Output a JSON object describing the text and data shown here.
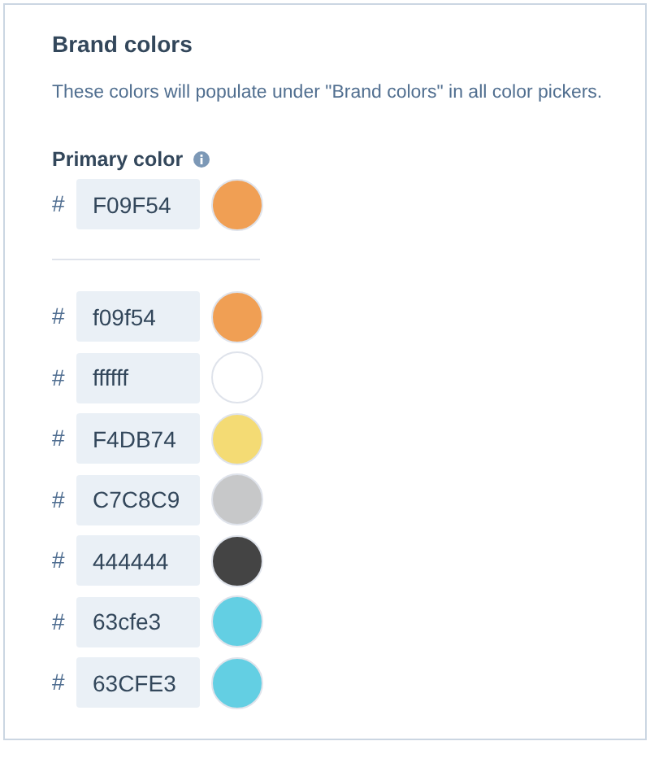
{
  "title": "Brand colors",
  "description": "These colors will populate under \"Brand colors\" in all color pickers.",
  "primary": {
    "label": "Primary color",
    "prefix": "#",
    "value": "F09F54",
    "color": "#f09f54"
  },
  "colors": [
    {
      "prefix": "#",
      "value": "f09f54",
      "color": "#f09f54"
    },
    {
      "prefix": "#",
      "value": "ffffff",
      "color": "#ffffff"
    },
    {
      "prefix": "#",
      "value": "F4DB74",
      "color": "#f4db74"
    },
    {
      "prefix": "#",
      "value": "C7C8C9",
      "color": "#c7c8c9"
    },
    {
      "prefix": "#",
      "value": "444444",
      "color": "#444444"
    },
    {
      "prefix": "#",
      "value": "63cfe3",
      "color": "#63cfe3"
    },
    {
      "prefix": "#",
      "value": "63CFE3",
      "color": "#63cfe3"
    }
  ]
}
